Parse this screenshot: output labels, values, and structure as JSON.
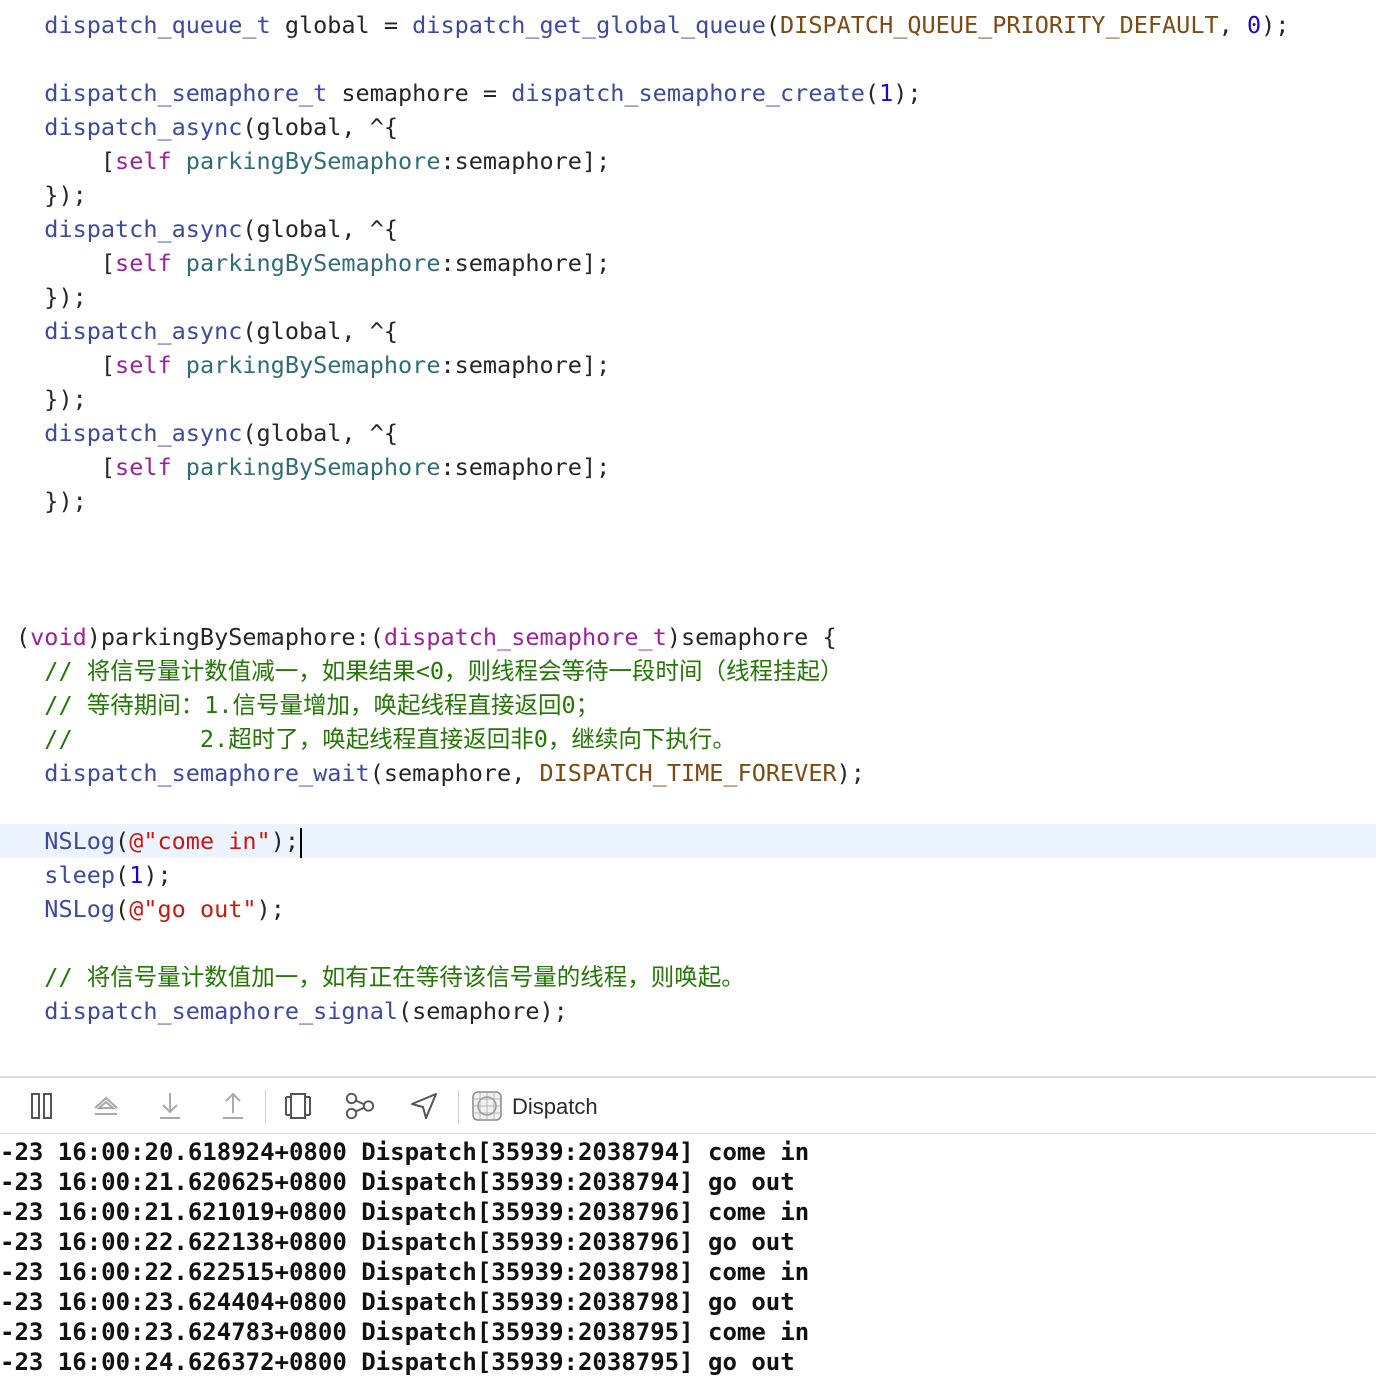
{
  "editor": {
    "code_lines": [
      {
        "segments": [
          {
            "t": "  ",
            "c": ""
          },
          {
            "t": "dispatch_queue_t",
            "c": "fn"
          },
          {
            "t": " global = ",
            "c": ""
          },
          {
            "t": "dispatch_get_global_queue",
            "c": "fn"
          },
          {
            "t": "(",
            "c": ""
          },
          {
            "t": "DISPATCH_QUEUE_PRIORITY_DEFAULT",
            "c": "mac"
          },
          {
            "t": ", ",
            "c": ""
          },
          {
            "t": "0",
            "c": "num"
          },
          {
            "t": ");",
            "c": ""
          }
        ]
      },
      {
        "segments": []
      },
      {
        "segments": [
          {
            "t": "  ",
            "c": ""
          },
          {
            "t": "dispatch_semaphore_t",
            "c": "fn"
          },
          {
            "t": " semaphore = ",
            "c": ""
          },
          {
            "t": "dispatch_semaphore_create",
            "c": "fn"
          },
          {
            "t": "(",
            "c": ""
          },
          {
            "t": "1",
            "c": "num"
          },
          {
            "t": ");",
            "c": ""
          }
        ]
      },
      {
        "segments": [
          {
            "t": "  ",
            "c": ""
          },
          {
            "t": "dispatch_async",
            "c": "fn"
          },
          {
            "t": "(global, ^{",
            "c": ""
          }
        ]
      },
      {
        "segments": [
          {
            "t": "      [",
            "c": ""
          },
          {
            "t": "self",
            "c": "kw"
          },
          {
            "t": " ",
            "c": ""
          },
          {
            "t": "parkingBySemaphore",
            "c": "fn2"
          },
          {
            "t": ":semaphore];",
            "c": ""
          }
        ]
      },
      {
        "segments": [
          {
            "t": "  });",
            "c": ""
          }
        ]
      },
      {
        "segments": [
          {
            "t": "  ",
            "c": ""
          },
          {
            "t": "dispatch_async",
            "c": "fn"
          },
          {
            "t": "(global, ^{",
            "c": ""
          }
        ]
      },
      {
        "segments": [
          {
            "t": "      [",
            "c": ""
          },
          {
            "t": "self",
            "c": "kw"
          },
          {
            "t": " ",
            "c": ""
          },
          {
            "t": "parkingBySemaphore",
            "c": "fn2"
          },
          {
            "t": ":semaphore];",
            "c": ""
          }
        ]
      },
      {
        "segments": [
          {
            "t": "  });",
            "c": ""
          }
        ]
      },
      {
        "segments": [
          {
            "t": "  ",
            "c": ""
          },
          {
            "t": "dispatch_async",
            "c": "fn"
          },
          {
            "t": "(global, ^{",
            "c": ""
          }
        ]
      },
      {
        "segments": [
          {
            "t": "      [",
            "c": ""
          },
          {
            "t": "self",
            "c": "kw"
          },
          {
            "t": " ",
            "c": ""
          },
          {
            "t": "parkingBySemaphore",
            "c": "fn2"
          },
          {
            "t": ":semaphore];",
            "c": ""
          }
        ]
      },
      {
        "segments": [
          {
            "t": "  });",
            "c": ""
          }
        ]
      },
      {
        "segments": [
          {
            "t": "  ",
            "c": ""
          },
          {
            "t": "dispatch_async",
            "c": "fn"
          },
          {
            "t": "(global, ^{",
            "c": ""
          }
        ]
      },
      {
        "segments": [
          {
            "t": "      [",
            "c": ""
          },
          {
            "t": "self",
            "c": "kw"
          },
          {
            "t": " ",
            "c": ""
          },
          {
            "t": "parkingBySemaphore",
            "c": "fn2"
          },
          {
            "t": ":semaphore];",
            "c": ""
          }
        ]
      },
      {
        "segments": [
          {
            "t": "  });",
            "c": ""
          }
        ]
      },
      {
        "segments": []
      },
      {
        "segments": []
      },
      {
        "segments": []
      },
      {
        "segments": [
          {
            "t": "(",
            "c": ""
          },
          {
            "t": "void",
            "c": "kw"
          },
          {
            "t": ")parkingBySemaphore:(",
            "c": ""
          },
          {
            "t": "dispatch_semaphore_t",
            "c": "kw"
          },
          {
            "t": ")semaphore {",
            "c": ""
          }
        ]
      },
      {
        "segments": [
          {
            "t": "  // 将信号量计数值减一，如果结果<0，则线程会等待一段时间（线程挂起）",
            "c": "cmt"
          }
        ]
      },
      {
        "segments": [
          {
            "t": "  // 等待期间：1.信号量增加，唤起线程直接返回0；",
            "c": "cmt"
          }
        ]
      },
      {
        "segments": [
          {
            "t": "  //         2.超时了，唤起线程直接返回非0，继续向下执行。",
            "c": "cmt"
          }
        ]
      },
      {
        "segments": [
          {
            "t": "  ",
            "c": ""
          },
          {
            "t": "dispatch_semaphore_wait",
            "c": "fn"
          },
          {
            "t": "(semaphore, ",
            "c": ""
          },
          {
            "t": "DISPATCH_TIME_FOREVER",
            "c": "mac"
          },
          {
            "t": ");",
            "c": ""
          }
        ]
      },
      {
        "segments": []
      },
      {
        "current": true,
        "segments": [
          {
            "t": "  ",
            "c": ""
          },
          {
            "t": "NSLog",
            "c": "fn"
          },
          {
            "t": "(",
            "c": ""
          },
          {
            "t": "@\"come in\"",
            "c": "str"
          },
          {
            "t": ");",
            "c": ""
          }
        ]
      },
      {
        "segments": [
          {
            "t": "  ",
            "c": ""
          },
          {
            "t": "sleep",
            "c": "fn"
          },
          {
            "t": "(",
            "c": ""
          },
          {
            "t": "1",
            "c": "num"
          },
          {
            "t": ");",
            "c": ""
          }
        ]
      },
      {
        "segments": [
          {
            "t": "  ",
            "c": ""
          },
          {
            "t": "NSLog",
            "c": "fn"
          },
          {
            "t": "(",
            "c": ""
          },
          {
            "t": "@\"go out\"",
            "c": "str"
          },
          {
            "t": ");",
            "c": ""
          }
        ]
      },
      {
        "segments": []
      },
      {
        "segments": [
          {
            "t": "  // 将信号量计数值加一，如有正在等待该信号量的线程，则唤起。",
            "c": "cmt"
          }
        ]
      },
      {
        "segments": [
          {
            "t": "  ",
            "c": ""
          },
          {
            "t": "dispatch_semaphore_signal",
            "c": "fn"
          },
          {
            "t": "(semaphore);",
            "c": ""
          }
        ]
      }
    ]
  },
  "debug_bar": {
    "target_name": "Dispatch",
    "icons": [
      "hide-debug-area-icon",
      "step-over-icon",
      "step-into-icon",
      "step-out-icon",
      "view-debugger-icon",
      "memory-graph-icon",
      "simulate-location-icon"
    ],
    "target_icon": "app-target-icon"
  },
  "console": {
    "lines": [
      "-23 16:00:20.618924+0800 Dispatch[35939:2038794] come in",
      "-23 16:00:21.620625+0800 Dispatch[35939:2038794] go out",
      "-23 16:00:21.621019+0800 Dispatch[35939:2038796] come in",
      "-23 16:00:22.622138+0800 Dispatch[35939:2038796] go out",
      "-23 16:00:22.622515+0800 Dispatch[35939:2038798] come in",
      "-23 16:00:23.624404+0800 Dispatch[35939:2038798] go out",
      "-23 16:00:23.624783+0800 Dispatch[35939:2038795] come in",
      "-23 16:00:24.626372+0800 Dispatch[35939:2038795] go out"
    ]
  },
  "colors": {
    "keyword": "#9b2393",
    "function": "#3e4a9c",
    "method": "#326d74",
    "macro": "#7a4a17",
    "number": "#1c00cf",
    "string": "#c41a16",
    "comment": "#267507",
    "current_line": "#ecf5ff"
  }
}
